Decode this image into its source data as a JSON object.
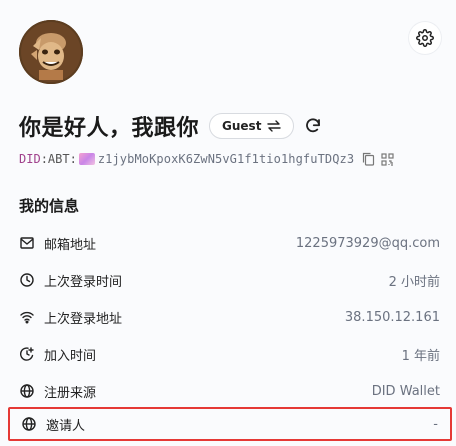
{
  "user": {
    "name": "你是好人，我跟你",
    "role": "Guest"
  },
  "did": {
    "prefix": "DID",
    "separator": ":",
    "method": "ABT:",
    "value": "z1jybMoKpoxK6ZwN5vG1f1tio1hgfuTDQz3"
  },
  "section_title": "我的信息",
  "info_rows": [
    {
      "label": "邮箱地址",
      "value": "1225973929@qq.com",
      "icon": "mail-icon"
    },
    {
      "label": "上次登录时间",
      "value": "2 小时前",
      "icon": "clock-icon"
    },
    {
      "label": "上次登录地址",
      "value": "38.150.12.161",
      "icon": "wifi-icon"
    },
    {
      "label": "加入时间",
      "value": "1 年前",
      "icon": "clock-plus-icon"
    },
    {
      "label": "注册来源",
      "value": "DID Wallet",
      "icon": "globe-icon"
    },
    {
      "label": "邀请人",
      "value": "-",
      "icon": "globe-icon"
    }
  ],
  "colors": {
    "did_prefix": "#a0418c",
    "highlight_border": "#e53935",
    "muted_text": "#6b7280"
  }
}
